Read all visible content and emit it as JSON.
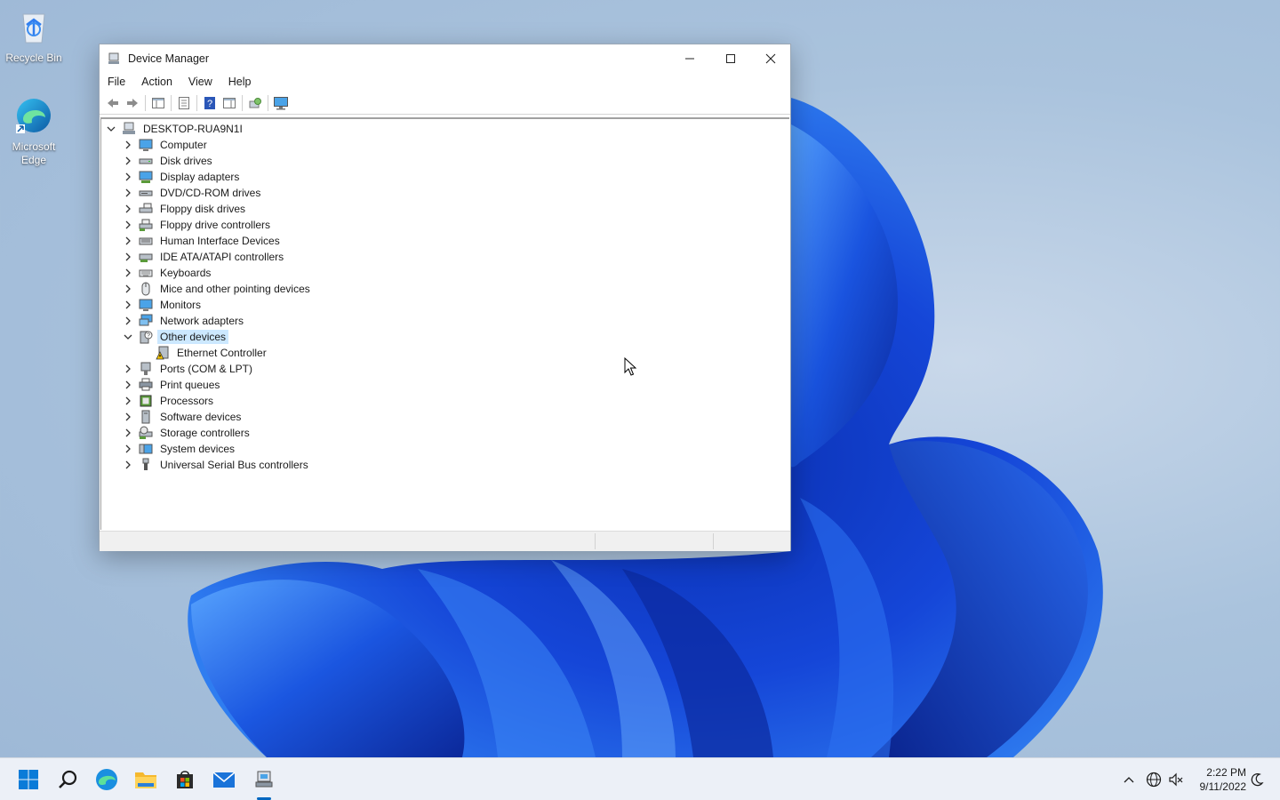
{
  "desktop": {
    "icons": [
      {
        "label": "Recycle Bin",
        "icon": "recycle-bin-icon"
      },
      {
        "label": "Microsoft Edge",
        "icon": "edge-icon"
      }
    ]
  },
  "window": {
    "title": "Device Manager",
    "menu": [
      "File",
      "Action",
      "View",
      "Help"
    ],
    "toolbar": [
      "back-arrow-icon",
      "forward-arrow-icon",
      "show-hide-console-tree-icon",
      "properties-icon",
      "help-icon",
      "action-pane-icon",
      "scan-hardware-icon",
      "monitor-icon"
    ],
    "tree": {
      "root": "DESKTOP-RUA9N1I",
      "categories": [
        "Computer",
        "Disk drives",
        "Display adapters",
        "DVD/CD-ROM drives",
        "Floppy disk drives",
        "Floppy drive controllers",
        "Human Interface Devices",
        "IDE ATA/ATAPI controllers",
        "Keyboards",
        "Mice and other pointing devices",
        "Monitors",
        "Network adapters",
        "Other devices",
        "Ports (COM & LPT)",
        "Print queues",
        "Processors",
        "Software devices",
        "Storage controllers",
        "System devices",
        "Universal Serial Bus controllers"
      ],
      "expanded_category": "Other devices",
      "selected": "Other devices",
      "other_devices_children": [
        "Ethernet Controller"
      ]
    }
  },
  "taskbar": {
    "apps": [
      "start-icon",
      "search-icon",
      "edge-icon",
      "file-explorer-icon",
      "store-icon",
      "mail-icon",
      "device-manager-icon"
    ],
    "clock_time": "2:22 PM",
    "clock_date": "9/11/2022"
  },
  "colors": {
    "selection": "#cce8ff",
    "accent": "#0067c0",
    "warning": "#f5c400"
  }
}
